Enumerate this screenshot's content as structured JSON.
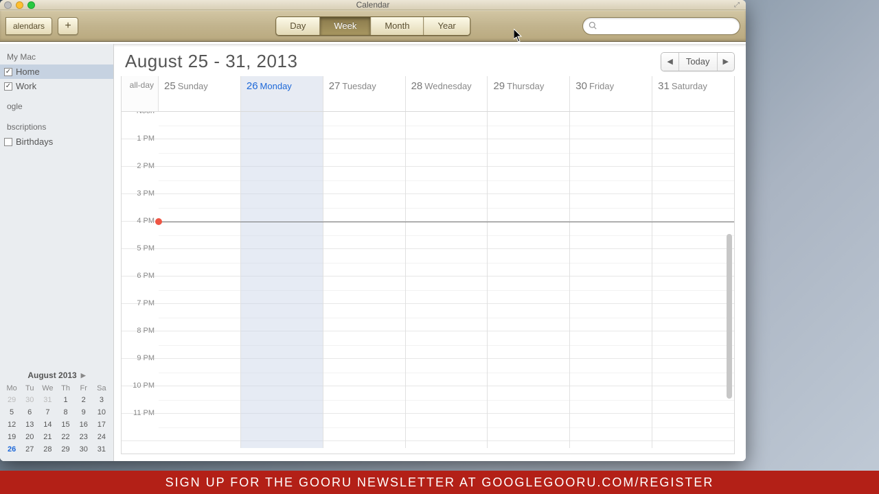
{
  "window": {
    "title": "Calendar"
  },
  "toolbar": {
    "calendars_label": "alendars",
    "views": [
      "Day",
      "Week",
      "Month",
      "Year"
    ],
    "active_view_index": 1
  },
  "sidebar": {
    "sections": [
      {
        "title": " My Mac",
        "items": [
          {
            "label": "Home",
            "checked": true,
            "selected": true
          },
          {
            "label": "Work",
            "checked": true,
            "selected": false
          }
        ]
      },
      {
        "title": "ogle",
        "items": []
      },
      {
        "title": "bscriptions",
        "items": [
          {
            "label": "Birthdays",
            "checked": false,
            "selected": false
          }
        ]
      }
    ]
  },
  "mini_month": {
    "title": "August 2013",
    "dow": [
      "Mo",
      "Tu",
      "We",
      "Th",
      "Fr",
      "Sa"
    ],
    "rows": [
      [
        {
          "d": "29",
          "dim": true
        },
        {
          "d": "30",
          "dim": true
        },
        {
          "d": "31",
          "dim": true
        },
        {
          "d": "1"
        },
        {
          "d": "2"
        },
        {
          "d": "3"
        }
      ],
      [
        {
          "d": "5"
        },
        {
          "d": "6"
        },
        {
          "d": "7"
        },
        {
          "d": "8"
        },
        {
          "d": "9"
        },
        {
          "d": "10"
        }
      ],
      [
        {
          "d": "12"
        },
        {
          "d": "13"
        },
        {
          "d": "14"
        },
        {
          "d": "15"
        },
        {
          "d": "16"
        },
        {
          "d": "17"
        }
      ],
      [
        {
          "d": "19"
        },
        {
          "d": "20"
        },
        {
          "d": "21"
        },
        {
          "d": "22"
        },
        {
          "d": "23"
        },
        {
          "d": "24"
        }
      ],
      [
        {
          "d": "26",
          "today": true
        },
        {
          "d": "27"
        },
        {
          "d": "28"
        },
        {
          "d": "29"
        },
        {
          "d": "30"
        },
        {
          "d": "31"
        }
      ]
    ]
  },
  "main": {
    "range_title": "August 25 - 31, 2013",
    "today_label": "Today",
    "allday_label": "all-day",
    "days": [
      {
        "num": "25",
        "name": "Sunday",
        "today": false
      },
      {
        "num": "26",
        "name": "Monday",
        "today": true
      },
      {
        "num": "27",
        "name": "Tuesday",
        "today": false
      },
      {
        "num": "28",
        "name": "Wednesday",
        "today": false
      },
      {
        "num": "29",
        "name": "Thursday",
        "today": false
      },
      {
        "num": "30",
        "name": "Friday",
        "today": false
      },
      {
        "num": "31",
        "name": "Saturday",
        "today": false
      }
    ],
    "hours": [
      "Noon",
      "1 PM",
      "2 PM",
      "3 PM",
      "4 PM",
      "5 PM",
      "6 PM",
      "7 PM",
      "8 PM",
      "9 PM",
      "10 PM",
      "11 PM"
    ],
    "now_hour_index": 4
  },
  "banner": "SIGN UP FOR THE GOORU NEWSLETTER AT GOOGLEGOORU.COM/REGISTER"
}
